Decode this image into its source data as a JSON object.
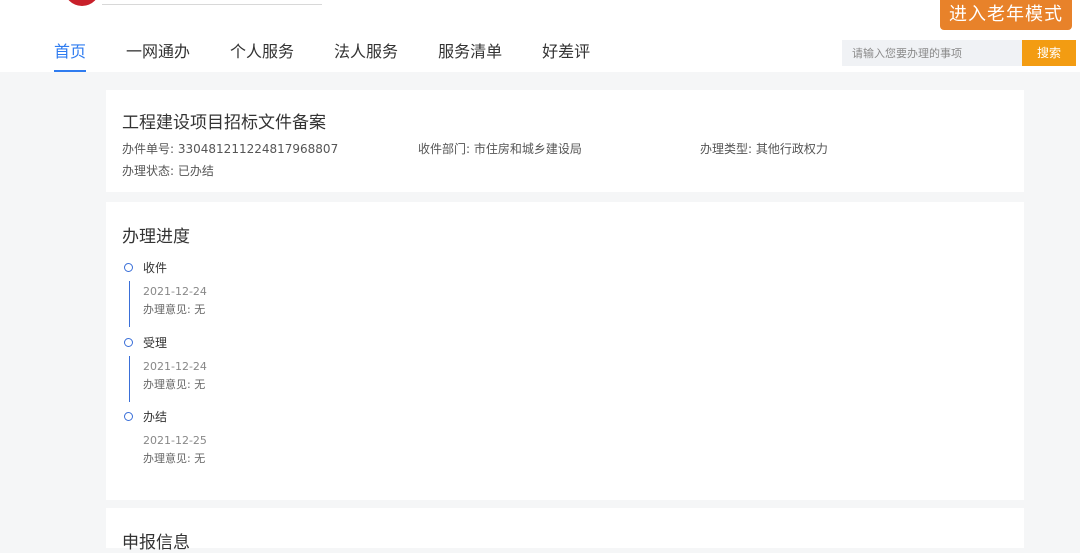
{
  "header": {
    "elder_mode_label": "进入老年模式",
    "nav": [
      {
        "label": "首页",
        "active": true
      },
      {
        "label": "一网通办",
        "active": false
      },
      {
        "label": "个人服务",
        "active": false
      },
      {
        "label": "法人服务",
        "active": false
      },
      {
        "label": "服务清单",
        "active": false
      },
      {
        "label": "好差评",
        "active": false
      }
    ],
    "search": {
      "placeholder": "请输入您要办理的事项",
      "button_label": "搜索"
    }
  },
  "matter": {
    "title": "工程建设项目招标文件备案",
    "case_no_label": "办件单号:",
    "case_no": "330481211224817968807",
    "department_label": "收件部门:",
    "department": "市住房和城乡建设局",
    "type_label": "办理类型:",
    "type": "其他行政权力",
    "status_label": "办理状态:",
    "status": "已办结"
  },
  "progress": {
    "title": "办理进度",
    "steps": [
      {
        "name": "收件",
        "date": "2021-12-24",
        "opinion": "办理意见: 无"
      },
      {
        "name": "受理",
        "date": "2021-12-24",
        "opinion": "办理意见: 无"
      },
      {
        "name": "办结",
        "date": "2021-12-25",
        "opinion": "办理意见: 无"
      }
    ]
  },
  "next_section": {
    "title": "申报信息"
  },
  "colors": {
    "accent": "#2f7cf0",
    "timeline": "#3a6fd8",
    "elder_button": "#e8822a",
    "search_button": "#f39c12"
  }
}
